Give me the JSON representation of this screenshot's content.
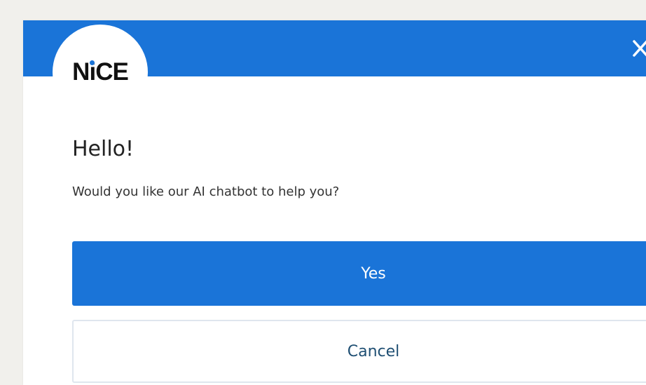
{
  "brand": {
    "logo_text_before": "N",
    "logo_text_i": "i",
    "logo_text_after": "CE",
    "accent_color": "#1a74d8"
  },
  "header": {
    "close_icon": "close-icon"
  },
  "dialog": {
    "heading": "Hello!",
    "message": "Would you like our AI chatbot to help you?"
  },
  "actions": {
    "yes_label": "Yes",
    "cancel_label": "Cancel"
  }
}
